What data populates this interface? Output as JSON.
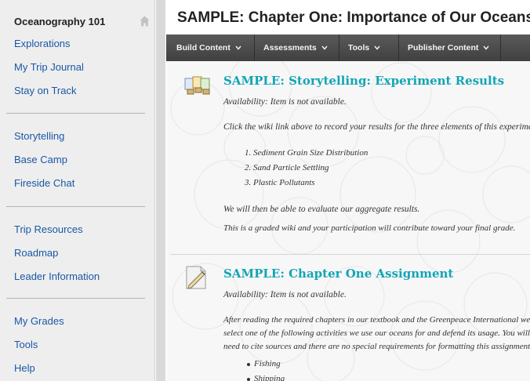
{
  "sidebar": {
    "course_title": "Oceanography 101",
    "groups": [
      [
        "Explorations",
        "My Trip Journal",
        "Stay on Track"
      ],
      [
        "Storytelling",
        "Base Camp",
        "Fireside Chat"
      ],
      [
        "Trip Resources",
        "Roadmap",
        "Leader Information"
      ],
      [
        "My Grades",
        "Tools",
        "Help"
      ]
    ]
  },
  "page_title": "SAMPLE: Chapter One: Importance of Our Oceans",
  "toolbar": {
    "build_content": "Build Content",
    "assessments": "Assessments",
    "tools": "Tools",
    "publisher_content": "Publisher Content"
  },
  "items": [
    {
      "title": "SAMPLE: Storytelling: Experiment Results",
      "availability": "Availability:  Item is not available.",
      "instructions": "Click the wiki link above to record your results for the three elements of this experiment",
      "list": [
        "1. Sediment Grain Size Distribution",
        "2. Sand Particle Settling",
        "3. Plastic Pollutants"
      ],
      "para1": "We will then be able to evaluate our aggregate results.",
      "para2": "This is a graded wiki and your participation will contribute toward your final grade."
    },
    {
      "title": "SAMPLE: Chapter One Assignment",
      "availability": "Availability:  Item is not available.",
      "lines": [
        "After reading the required chapters in our textbook and the Greenpeace International website,",
        "select one of the following activities we use our oceans for and defend its usage. You will",
        "need to cite sources and there are no special requirements for formatting this assignment."
      ],
      "bullets": [
        "Fishing",
        "Shipping"
      ]
    }
  ],
  "colors": {
    "link": "#1b57a6",
    "item_title": "#12a5b5",
    "toolbar": "#4a4a4a",
    "sidebar_bg": "#eeeeee"
  }
}
